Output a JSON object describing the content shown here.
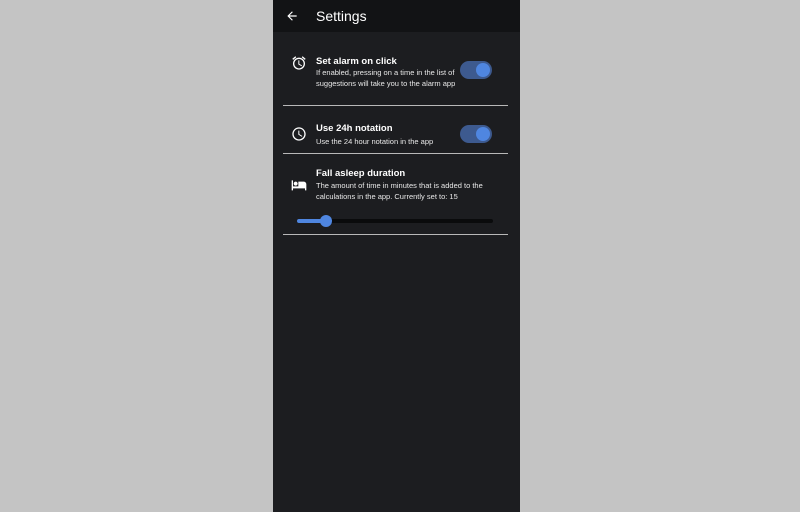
{
  "appbar": {
    "title": "Settings"
  },
  "settings": [
    {
      "icon": "alarm-clock-icon",
      "title": "Set alarm on click",
      "description": "If enabled, pressing on a time in the list of suggestions will take you to the alarm app",
      "enabled": true
    },
    {
      "icon": "clock-icon",
      "title": "Use 24h notation",
      "description": "Use the 24 hour notation in the app",
      "enabled": true
    },
    {
      "icon": "bed-icon",
      "title": "Fall asleep duration",
      "description": "The amount of time in minutes that is added to the calculations in the app. Currently set to: 15",
      "slider_fraction": 0.15
    }
  ],
  "colors": {
    "accent": "#4f86e0",
    "toggle_track": "#3d5a8f",
    "surface": "#1c1d20",
    "appbar": "#121315",
    "divider": "#b8b8b8"
  }
}
